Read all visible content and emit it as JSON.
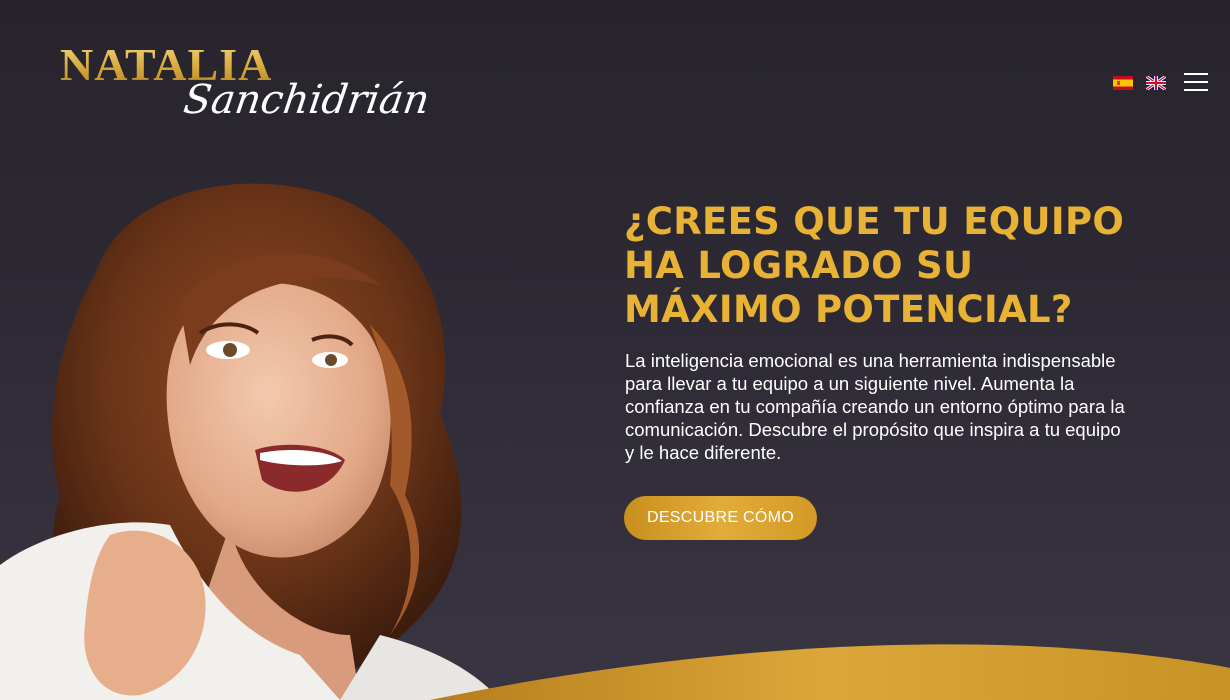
{
  "logo": {
    "line1": "NATALIA",
    "line2": "Sanchidrián"
  },
  "header": {
    "languages": [
      {
        "code": "es",
        "icon": "spain-flag-icon"
      },
      {
        "code": "en",
        "icon": "uk-flag-icon"
      }
    ],
    "menu_icon": "hamburger-menu-icon"
  },
  "hero": {
    "headline": "¿CREES QUE TU EQUIPO HA LOGRADO SU MÁXIMO POTENCIAL?",
    "body": "La inteligencia emocional es una herramienta indispensable para llevar a tu equipo a un siguiente nivel. Aumenta la confianza en tu compañía creando un entorno óptimo para la comunicación. Descubre el propósito que inspira a tu equipo y le hace diferente.",
    "cta_label": "DESCUBRE CÓMO"
  },
  "colors": {
    "background": "#2a2630",
    "accent_gold": "#e8b234",
    "button_gold": "#d39a24",
    "text": "#ffffff"
  }
}
